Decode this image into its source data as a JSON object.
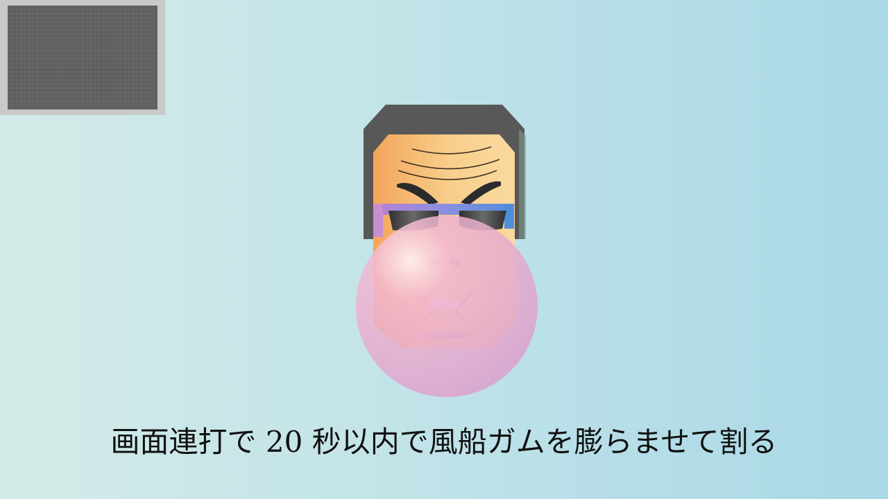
{
  "instruction_text": "画面連打で 20 秒以内で風船ガムを膨らませて割る",
  "colors": {
    "background_left": "#d3ebe8",
    "background_right": "#a9d8e6",
    "hair": "#585858",
    "skin_light": "#f8cf8c",
    "skin_dark": "#f3a55a",
    "glasses_frame": "#6a8fd6",
    "lenses": "#3b3b3b",
    "bubble": "#e09ac9",
    "text": "#111111"
  },
  "icons": {
    "preview": "minimap-preview",
    "character": "face-character",
    "bubble": "bubble-gum-icon"
  }
}
